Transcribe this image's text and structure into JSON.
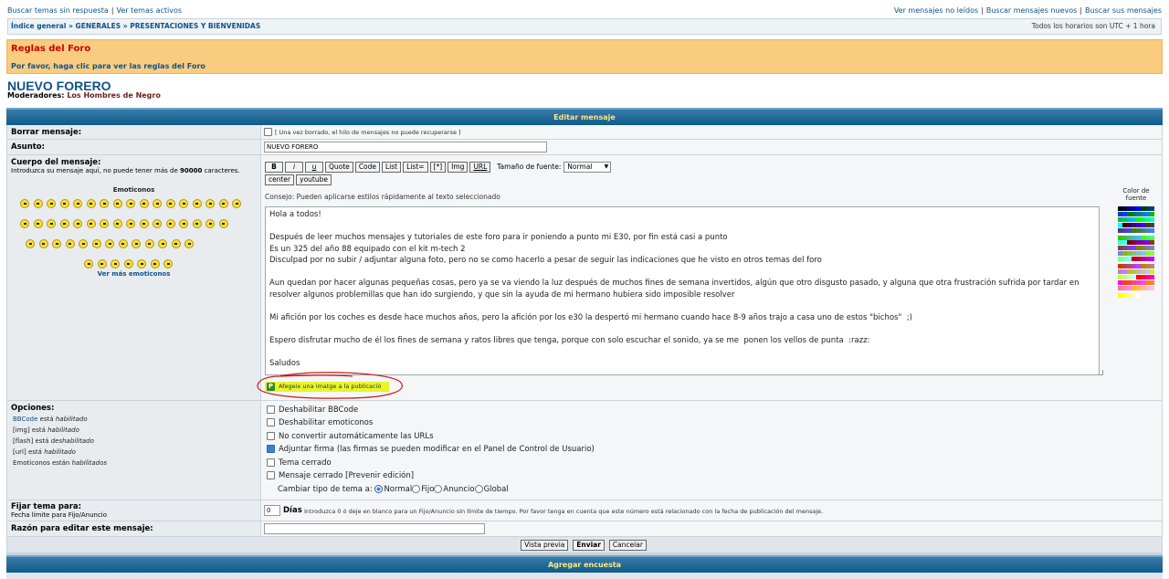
{
  "top": {
    "left_links": [
      "Buscar temas sin respuesta",
      "Ver temas activos"
    ],
    "right_links": [
      "Ver mensajes no leídos",
      "Buscar mensajes nuevos",
      "Buscar sus mensajes"
    ]
  },
  "breadcrumb": {
    "items": [
      "Índice general",
      "GENERALES",
      "PRESENTACIONES Y BIENVENIDAS"
    ],
    "sep": "»",
    "timezone": "Todos los horarios son UTC + 1 hora"
  },
  "rules": {
    "title": "Reglas del Foro",
    "text": "Por favor, haga clic para ver las reglas del Foro"
  },
  "page": {
    "title": "NUEVO FORERO",
    "moderators_label": "Moderadores:",
    "moderators": "Los Hombres de Negro"
  },
  "form": {
    "header": "Editar mensaje",
    "delete_label": "Borrar mensaje:",
    "delete_note": "[ Una vez borrado, el hilo de mensajes no puede recuperarse ]",
    "subject_label": "Asunto:",
    "subject_value": "NUEVO FORERO",
    "body_label": "Cuerpo del mensaje:",
    "body_hint_pre": "Introduzca su mensaje aquí, no puede tener más de ",
    "body_hint_num": "90000",
    "body_hint_post": " caracteres.",
    "emoticons_title": "Emoticonos",
    "more_emoticons": "Ver más emoticonos",
    "bbcode_buttons": [
      "B",
      "i",
      "u",
      "Quote",
      "Code",
      "List",
      "List=",
      "[*]",
      "Img",
      "URL"
    ],
    "font_size_label": "Tamaño de fuente:",
    "font_size_value": "Normal",
    "extra_buttons": [
      "center",
      "youtube"
    ],
    "tip": "Consejo: Pueden aplicarse estilos rápidamente al texto seleccionado",
    "message": "Hola a todos!\n\nDespués de leer muchos mensajes y tutoriales de este foro para ir poniendo a punto mi E30, por fin está casi a punto\nEs un 325 del año 88 equipado con el kit m-tech 2\nDisculpad por no subir / adjuntar alguna foto, pero no se como hacerlo a pesar de seguir las indicaciones que he visto en otros temas del foro\n\nAun quedan por hacer algunas pequeñas cosas, pero ya se va viendo la luz después de muchos fines de semana invertidos, algún que otro disgusto pasado, y alguna que otra frustración sufrida por tardar en resolver algunos problemillas que han ido surgiendo, y que sin la ayuda de mi hermano hubiera sido imposible resolver\n\nMi afición por los coches es desde hace muchos años, pero la afición por los e30 la despertó mi hermano cuando hace 8-9 años trajo a casa uno de estos \"bichos\"  ;)\n\nEspero disfrutar mucho de él los fines de semana y ratos libres que tenga, porque con solo escuchar el sonido, ya se me  ponen los vellos de punta  :razz:\n\nSaludos",
    "font_color_label": "Color de fuente",
    "add_image": "Afegeix una imatge a la publicació",
    "options_label": "Opciones:",
    "options_status": [
      {
        "name": "BBCode",
        "text": " está ",
        "state": "habilitado"
      },
      {
        "name": "[img]",
        "text": " está ",
        "state": "habilitado"
      },
      {
        "name": "[flash]",
        "text": " está ",
        "state": "deshabilitado"
      },
      {
        "name": "[url]",
        "text": " está ",
        "state": "habilitado"
      },
      {
        "name": "Emoticonos",
        "text": " están ",
        "state": "habilitados"
      }
    ],
    "checkboxes": [
      {
        "label": "Deshabilitar BBCode",
        "checked": false
      },
      {
        "label": "Deshabilitar emoticonos",
        "checked": false
      },
      {
        "label": "No convertir automáticamente las URLs",
        "checked": false
      },
      {
        "label": "Adjuntar firma (las firmas se pueden modificar en el Panel de Control de Usuario)",
        "checked": true
      },
      {
        "label": "Tema cerrado",
        "checked": false
      },
      {
        "label": "Mensaje cerrado [Prevenir edición]",
        "checked": false
      }
    ],
    "topic_type_label": "Cambiar tipo de tema a:",
    "topic_types": [
      {
        "label": "Normal",
        "selected": true
      },
      {
        "label": "Fijo",
        "selected": false
      },
      {
        "label": "Anuncio",
        "selected": false
      },
      {
        "label": "Global",
        "selected": false
      }
    ],
    "pin_label": "Fijar tema para:",
    "pin_sub": "Fecha límite para Fijo/Anuncio",
    "pin_value": "0",
    "pin_unit": "Días",
    "pin_note": "Introduzca 0 ó deje en blanco para un Fijo/Anuncio sin límite de tiempo. Por favor tenga en cuenta que este número está relacionado con la fecha de publicación del mensaje.",
    "reason_label": "Razón para editar este mensaje:",
    "reason_value": "",
    "buttons": {
      "preview": "Vista previa",
      "submit": "Enviar",
      "cancel": "Cancelar"
    },
    "poll_header": "Agregar encuesta"
  },
  "colors": {
    "link": "#105289",
    "rules_bg": "#f9cc80",
    "rules_title": "#cc0000",
    "header_text": "#ffe77e",
    "highlight": "#e8f52a",
    "annotation": "#d01818"
  }
}
